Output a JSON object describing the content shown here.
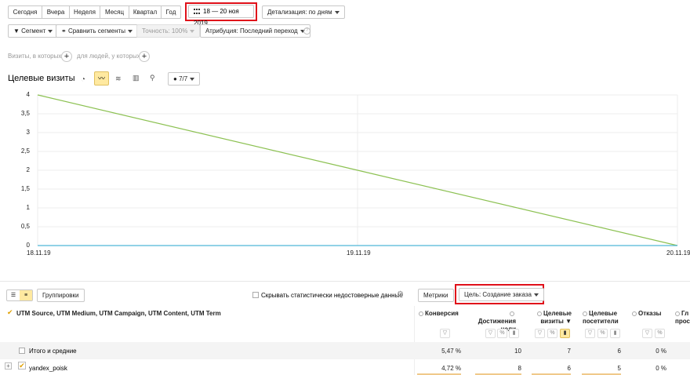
{
  "period_buttons": [
    "Сегодня",
    "Вчера",
    "Неделя",
    "Месяц",
    "Квартал",
    "Год"
  ],
  "date_range": "18 — 20 ноя 2019",
  "detail": "Детализация: по дням",
  "toolbar2": {
    "segment": "Сегмент",
    "compare": "Сравнить сегменты",
    "accuracy": "Точность: 100%",
    "attribution": "Атрибуция: Последний переход"
  },
  "filter_row": {
    "visits_label": "Визиты, в которых",
    "people_label": "для людей, у которых"
  },
  "chart_header": {
    "title": "Целевые визиты",
    "series_count": "7/7"
  },
  "chart_data": {
    "type": "line",
    "x": [
      "18.11.19",
      "19.11.19",
      "20.11.19"
    ],
    "series": [
      {
        "values": [
          4,
          2,
          0
        ],
        "color": "#8cc152"
      },
      {
        "values": [
          0,
          0,
          0
        ],
        "color": "#4fb8d8"
      }
    ],
    "ylim": [
      0,
      4
    ],
    "yticks": [
      "4",
      "3,5",
      "3",
      "2,5",
      "2",
      "1,5",
      "1",
      "0,5",
      "0"
    ],
    "grid": true
  },
  "table_toolbar": {
    "groupings": "Группировки",
    "hide_unreliable": "Скрывать статистически недостоверные данные",
    "metrics": "Метрики",
    "goal": "Цель: Создание заказа"
  },
  "table": {
    "dimension_header": "UTM Source, UTM Medium, UTM Campaign, UTM Content, UTM Term",
    "columns": [
      {
        "line1": "Конверсия",
        "line2": ""
      },
      {
        "line1": "Достижения",
        "line2": "цели"
      },
      {
        "line1": "Целевые",
        "line2": "визиты ▼"
      },
      {
        "line1": "Целевые",
        "line2": "посетители"
      },
      {
        "line1": "Отказы",
        "line2": ""
      },
      {
        "line1": "Гл",
        "line2": "прос"
      }
    ],
    "totals": {
      "label": "Итого и средние",
      "values": [
        "5,47 %",
        "10",
        "7",
        "6",
        "0 %"
      ]
    },
    "rows": [
      {
        "label": "yandex_poisk",
        "values": [
          "4,72 %",
          "8",
          "6",
          "5",
          "0 %"
        ]
      }
    ]
  }
}
